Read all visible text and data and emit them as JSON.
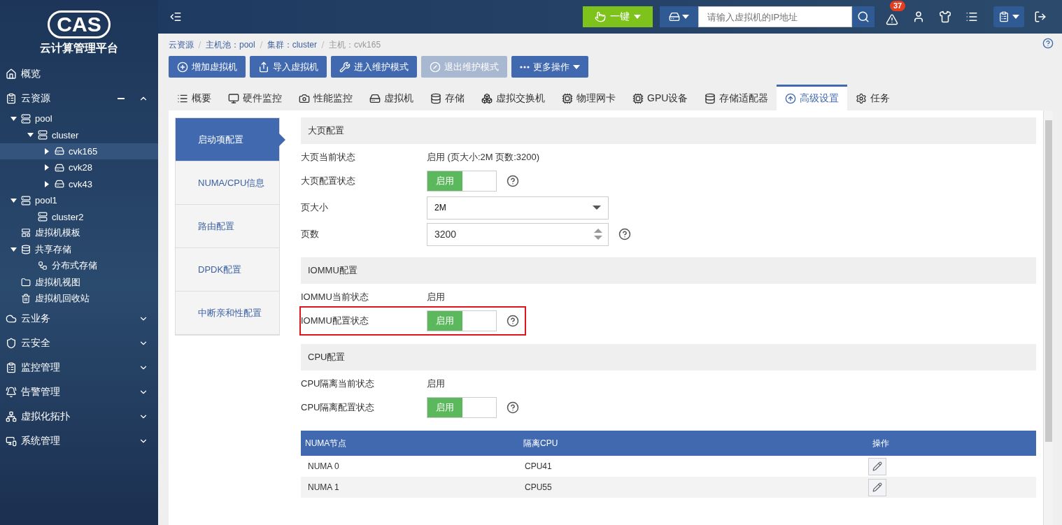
{
  "logo": {
    "text": "CAS",
    "subtitle": "云计算管理平台"
  },
  "sidebar": {
    "items": [
      {
        "label": "概览"
      },
      {
        "label": "云资源",
        "expanded": true,
        "children": [
          {
            "label": "pool",
            "kind": "pool",
            "expanded": true,
            "selected": false,
            "children": [
              {
                "label": "cluster",
                "kind": "cluster",
                "expanded": true,
                "selected": false,
                "children": [
                  {
                    "label": "cvk165",
                    "kind": "host",
                    "expanded": false,
                    "selected": true
                  },
                  {
                    "label": "cvk28",
                    "kind": "host",
                    "expanded": false,
                    "selected": false
                  },
                  {
                    "label": "cvk43",
                    "kind": "host",
                    "expanded": false,
                    "selected": false
                  }
                ]
              }
            ]
          },
          {
            "label": "pool1",
            "kind": "pool",
            "expanded": true,
            "selected": false,
            "children": [
              {
                "label": "cluster2",
                "kind": "cluster",
                "selected": false
              }
            ]
          },
          {
            "label": "虚拟机模板",
            "kind": "template",
            "selected": false
          },
          {
            "label": "共享存储",
            "kind": "storage",
            "expanded": true,
            "selected": false,
            "children": [
              {
                "label": "分布式存储",
                "kind": "distributed",
                "selected": false
              }
            ]
          },
          {
            "label": "虚拟机视图",
            "kind": "folder",
            "selected": false
          },
          {
            "label": "虚拟机回收站",
            "kind": "trash",
            "selected": false
          }
        ]
      },
      {
        "label": "云业务",
        "expanded": false
      },
      {
        "label": "云安全",
        "expanded": false
      },
      {
        "label": "监控管理",
        "expanded": false
      },
      {
        "label": "告警管理",
        "expanded": false
      },
      {
        "label": "虚拟化拓扑",
        "expanded": false
      },
      {
        "label": "系统管理",
        "expanded": false
      }
    ]
  },
  "topbar": {
    "one_key": "一键",
    "search": {
      "placeholder": "请输入虚拟机的IP地址"
    },
    "alert_count": "37"
  },
  "breadcrumb": [
    {
      "label": "云资源",
      "current": false
    },
    {
      "label": "主机池：pool",
      "current": false
    },
    {
      "label": "集群：cluster",
      "current": false
    },
    {
      "label": "主机：cvk165",
      "current": true
    }
  ],
  "actions": [
    {
      "label": "增加虚拟机",
      "disabled": false
    },
    {
      "label": "导入虚拟机",
      "disabled": false
    },
    {
      "label": "进入维护模式",
      "disabled": false
    },
    {
      "label": "退出维护模式",
      "disabled": true
    },
    {
      "label": "更多操作",
      "disabled": false
    }
  ],
  "tabs": [
    {
      "label": "概要",
      "selected": false
    },
    {
      "label": "硬件监控",
      "selected": false
    },
    {
      "label": "性能监控",
      "selected": false
    },
    {
      "label": "虚拟机",
      "selected": false
    },
    {
      "label": "存储",
      "selected": false
    },
    {
      "label": "虚拟交换机",
      "selected": false
    },
    {
      "label": "物理网卡",
      "selected": false
    },
    {
      "label": "GPU设备",
      "selected": false
    },
    {
      "label": "存储适配器",
      "selected": false
    },
    {
      "label": "高级设置",
      "selected": true
    },
    {
      "label": "任务",
      "selected": false
    }
  ],
  "side_menu": [
    {
      "label": "启动项配置",
      "selected": true
    },
    {
      "label": "NUMA/CPU信息",
      "selected": false
    },
    {
      "label": "路由配置",
      "selected": false
    },
    {
      "label": "DPDK配置",
      "selected": false
    },
    {
      "label": "中断亲和性配置",
      "selected": false
    }
  ],
  "sections": [
    {
      "title": "大页配置",
      "rows": [
        {
          "kind": "text",
          "label": "大页当前状态",
          "value": "启用 (页大小:2M 页数:3200)"
        },
        {
          "kind": "toggle",
          "label": "大页配置状态",
          "value": "启用",
          "on": true,
          "highlighted": false
        },
        {
          "kind": "select",
          "label": "页大小",
          "value": "2M"
        },
        {
          "kind": "number",
          "label": "页数",
          "value": "3200"
        }
      ]
    },
    {
      "title": "IOMMU配置",
      "rows": [
        {
          "kind": "text",
          "label": "IOMMU当前状态",
          "value": "启用"
        },
        {
          "kind": "toggle",
          "label": "IOMMU配置状态",
          "value": "启用",
          "on": true,
          "highlighted": true
        }
      ]
    },
    {
      "title": "CPU配置",
      "rows": [
        {
          "kind": "text",
          "label": "CPU隔离当前状态",
          "value": "启用"
        },
        {
          "kind": "toggle",
          "label": "CPU隔离配置状态",
          "value": "启用",
          "on": true,
          "highlighted": false
        }
      ],
      "table": {
        "columns": [
          "NUMA节点",
          "隔离CPU",
          "操作"
        ],
        "rows": [
          [
            "NUMA 0",
            "CPU41"
          ],
          [
            "NUMA 1",
            "CPU55"
          ]
        ]
      }
    }
  ]
}
